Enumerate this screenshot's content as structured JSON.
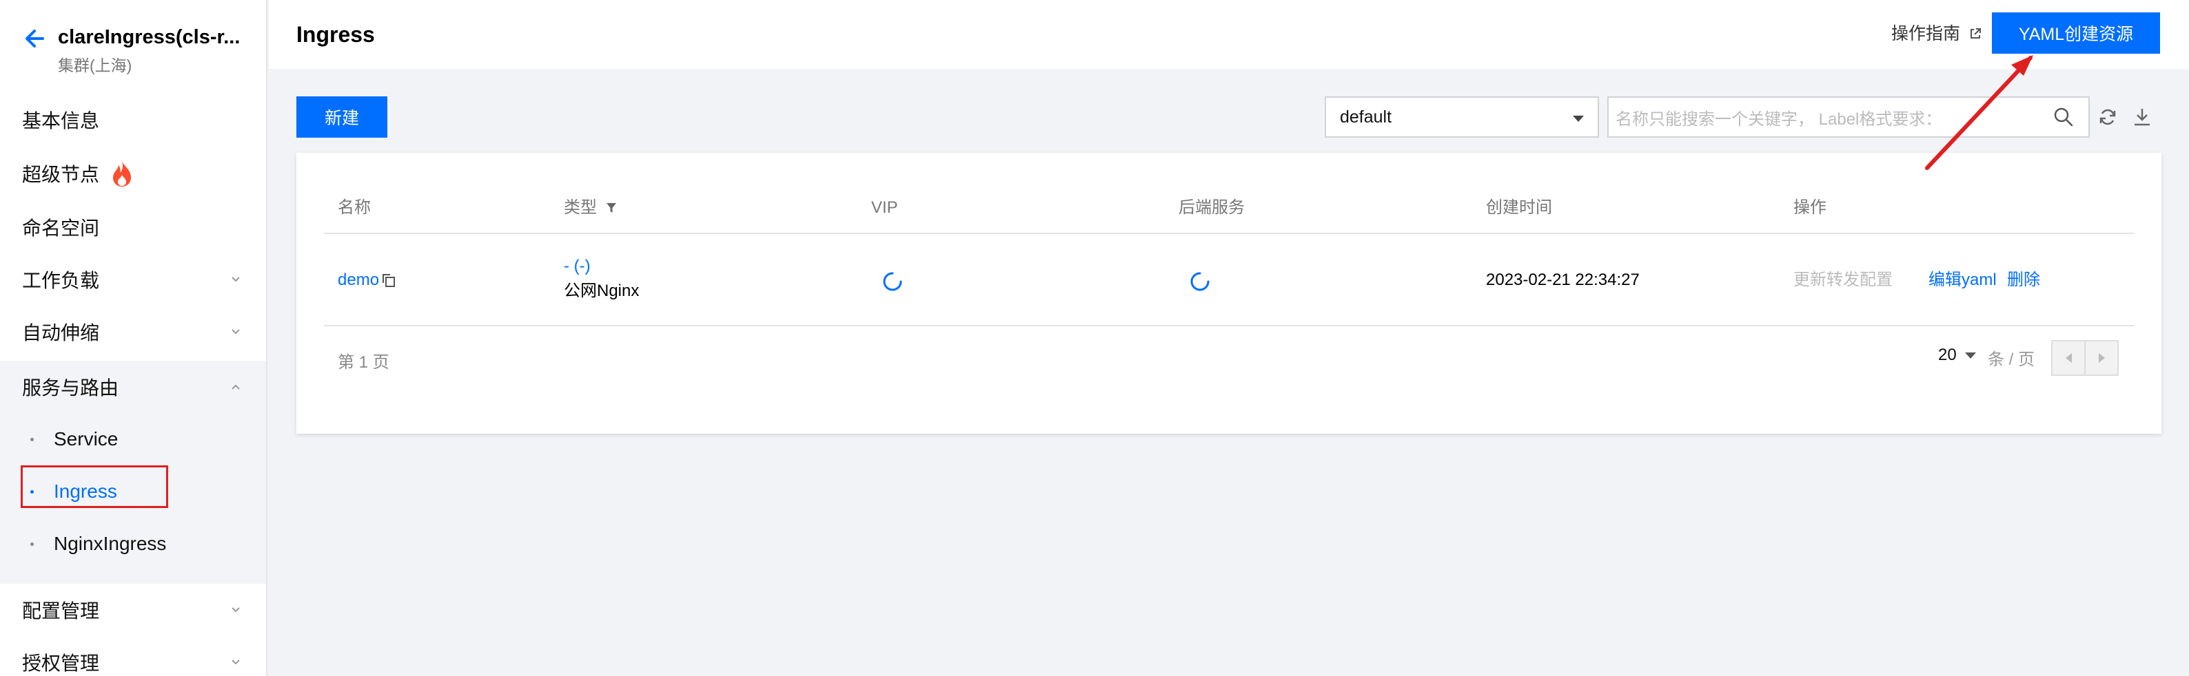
{
  "sidebar": {
    "title": "clareIngress(cls-r...",
    "subtitle": "集群(上海)",
    "items": [
      {
        "label": "基本信息"
      },
      {
        "label": "超级节点"
      },
      {
        "label": "命名空间"
      },
      {
        "label": "工作负载"
      },
      {
        "label": "自动伸缩"
      },
      {
        "label": "服务与路由"
      },
      {
        "label": "配置管理"
      },
      {
        "label": "授权管理"
      }
    ],
    "subitems": [
      {
        "label": "Service"
      },
      {
        "label": "Ingress"
      },
      {
        "label": "NginxIngress"
      }
    ]
  },
  "header": {
    "title": "Ingress",
    "guide_label": "操作指南",
    "yaml_button": "YAML创建资源"
  },
  "toolbar": {
    "new_button": "新建",
    "namespace": "default",
    "search_placeholder": "名称只能搜索一个关键字， Label格式要求："
  },
  "table": {
    "columns": [
      "名称",
      "类型",
      "VIP",
      "后端服务",
      "创建时间",
      "操作"
    ],
    "rows": [
      {
        "name": "demo",
        "type_link": "- (-)",
        "type_text": "公网Nginx",
        "created": "2023-02-21 22:34:27",
        "actions": [
          "更新转发配置",
          "编辑yaml",
          "删除"
        ]
      }
    ]
  },
  "pagination": {
    "page_label": "第 1 页",
    "page_size": "20",
    "unit": "条 / 页"
  },
  "colors": {
    "accent": "#006eff",
    "highlight_box": "#e02020",
    "annotation_arrow": "#e02020"
  }
}
